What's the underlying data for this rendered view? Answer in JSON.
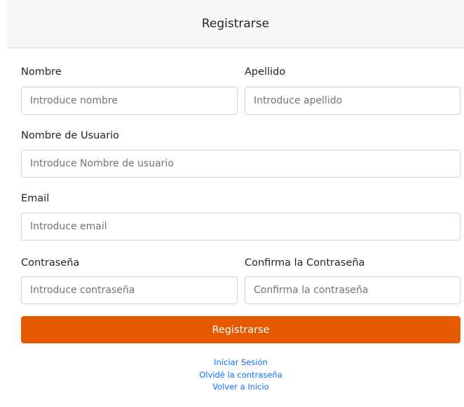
{
  "header": {
    "title": "Registrarse"
  },
  "form": {
    "first_name": {
      "label": "Nombre",
      "placeholder": "Introduce nombre",
      "value": ""
    },
    "last_name": {
      "label": "Apellido",
      "placeholder": "Introduce apellido",
      "value": ""
    },
    "username": {
      "label": "Nombre de Usuario",
      "placeholder": "Introduce Nombre de usuario",
      "value": ""
    },
    "email": {
      "label": "Email",
      "placeholder": "Introduce email",
      "value": ""
    },
    "password": {
      "label": "Contraseña",
      "placeholder": "Introduce contraseña",
      "value": ""
    },
    "confirm_password": {
      "label": "Confirma la Contraseña",
      "placeholder": "Confirma la contraseña",
      "value": ""
    },
    "submit_label": "Registrarse"
  },
  "links": {
    "login": "Iniciar Sesión",
    "forgot_password": "Olvidé la contraseña",
    "back_home": "Volver a Inicio"
  },
  "colors": {
    "accent": "#e55a00",
    "link": "#0d6efd",
    "header_bg": "#f7f7f7"
  }
}
